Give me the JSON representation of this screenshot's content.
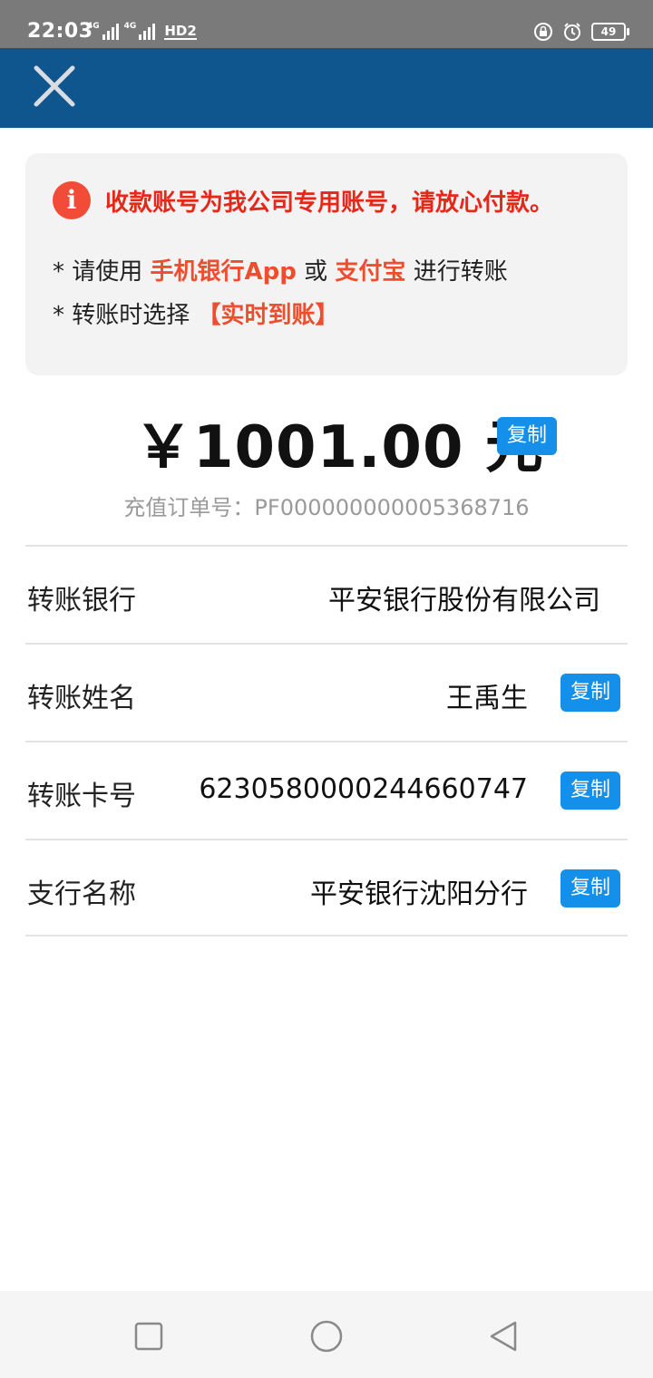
{
  "status_bar": {
    "time": "22:03",
    "network1": "4G",
    "network2": "4G",
    "hd_label": "HD2",
    "battery": "49"
  },
  "header": {
    "close_icon": "close-icon"
  },
  "notice": {
    "icon": "info-icon",
    "headline": "收款账号为我公司专用账号，请放心付款。",
    "line1_prefix": "* 请使用 ",
    "line1_hl1": "手机银行App",
    "line1_mid": " 或 ",
    "line1_hl2": "支付宝",
    "line1_suffix": " 进行转账",
    "line2_prefix": "* 转账时选择 ",
    "line2_hl": "【实时到账】"
  },
  "amount": {
    "value": "￥1001.00 元",
    "copy_label": "复制"
  },
  "order": {
    "text": "充值订单号：PF000000000005368716"
  },
  "details": [
    {
      "label": "转账银行",
      "value": "平安银行股份有限公司"
    },
    {
      "label": "转账姓名",
      "value": "王禹生",
      "copy_label": "复制"
    },
    {
      "label": "转账卡号",
      "value": "6230580000244660747",
      "copy_label": "复制"
    },
    {
      "label": "支行名称",
      "value": "平安银行沈阳分行",
      "copy_label": "复制"
    }
  ],
  "colors": {
    "header_bg": "#0f558e",
    "accent_red": "#e5281a",
    "copy_button": "#1490ea"
  }
}
